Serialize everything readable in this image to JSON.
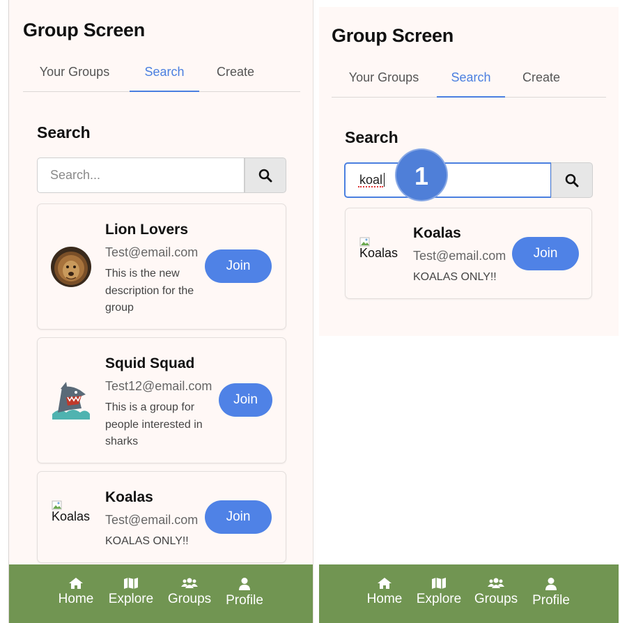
{
  "left": {
    "title": "Group Screen",
    "tabs": [
      {
        "label": "Your Groups",
        "active": false
      },
      {
        "label": "Search",
        "active": true
      },
      {
        "label": "Create",
        "active": false
      }
    ],
    "section_title": "Search",
    "search": {
      "placeholder": "Search...",
      "value": ""
    },
    "groups": [
      {
        "name": "Lion Lovers",
        "email": "Test@email.com",
        "description": "This is the new description for the group",
        "join_label": "Join",
        "image": "lion-photo"
      },
      {
        "name": "Squid Squad",
        "email": "Test12@email.com",
        "description": "This is a group for people interested in sharks",
        "join_label": "Join",
        "image": "shark-cartoon"
      },
      {
        "name": "Koalas",
        "email": "Test@email.com",
        "description": "KOALAS ONLY!!",
        "join_label": "Join",
        "image_alt": "Koalas"
      }
    ]
  },
  "right": {
    "title": "Group Screen",
    "tabs": [
      {
        "label": "Your Groups",
        "active": false
      },
      {
        "label": "Search",
        "active": true
      },
      {
        "label": "Create",
        "active": false
      }
    ],
    "section_title": "Search",
    "search": {
      "placeholder": "Search...",
      "value": "koal"
    },
    "step_badge": "1",
    "groups": [
      {
        "name": "Koalas",
        "email": "Test@email.com",
        "description": "KOALAS ONLY!!",
        "join_label": "Join",
        "image_alt": "Koalas"
      }
    ]
  },
  "nav": {
    "items": [
      {
        "label": "Home",
        "icon": "home-icon"
      },
      {
        "label": "Explore",
        "icon": "map-icon"
      },
      {
        "label": "Groups",
        "icon": "users-icon"
      },
      {
        "label": "Profile",
        "icon": "user-icon"
      }
    ]
  },
  "colors": {
    "accent": "#4a7fe0",
    "join_button": "#4f82e6",
    "nav_bg": "#719552",
    "screen_bg": "#fff8f6",
    "badge": "#4f7fd8"
  }
}
